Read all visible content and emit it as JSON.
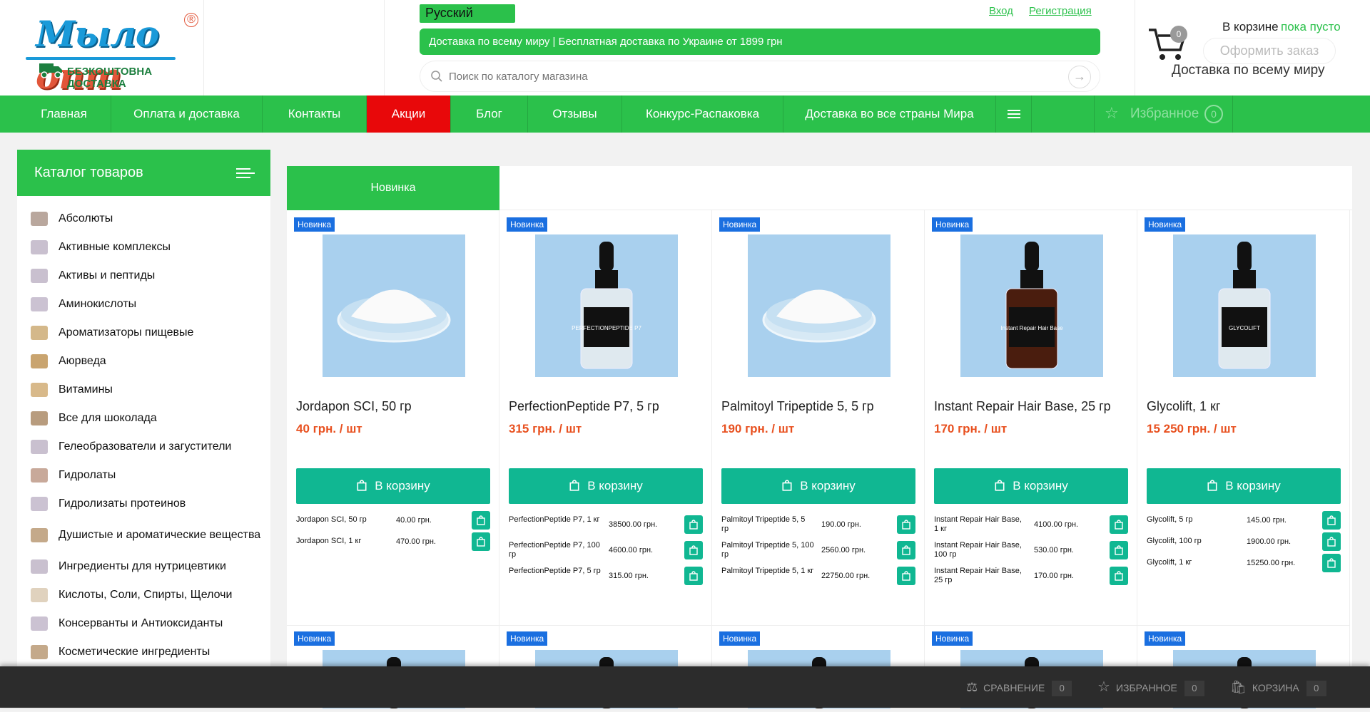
{
  "header": {
    "logo_text": "Мыло опт",
    "logo_sub": "БЕЗКОШТОВНА ДОСТАВКА",
    "language": "Русский",
    "login": "Вход",
    "register": "Регистрация",
    "promo": "Доставка по всему миру  |  Бесплатная доставка по Украине от 1899 грн",
    "search_placeholder": "Поиск по каталогу магазина",
    "cart_count": "0",
    "cart_label": "В корзине",
    "cart_status": "пока пусто",
    "order_button": "Оформить заказ",
    "shipping_note": "Доставка по всему миру"
  },
  "nav": {
    "items": [
      "Главная",
      "Оплата и доставка",
      "Контакты",
      "Акции",
      "Блог",
      "Отзывы",
      "Конкурс-Распаковка",
      "Доставка во все страны Мира"
    ],
    "favorites_label": "Избранное",
    "favorites_count": "0"
  },
  "sidebar": {
    "title": "Каталог товаров",
    "categories": [
      "Абсолюты",
      "Активные комплексы",
      "Активы и пептиды",
      "Аминокислоты",
      "Ароматизаторы пищевые",
      "Аюрведа",
      "Витамины",
      "Все для шоколада",
      "Гелеобразователи и загустители",
      "Гидролаты",
      "Гидролизаты протеинов",
      "Душистые и ароматические вещества",
      "Ингредиенты для нутрицевтики",
      "Кислоты, Соли, Спирты, Щелочи",
      "Консерванты и Антиоксиданты",
      "Косметические ингредиенты"
    ]
  },
  "tabs": {
    "active": "Новинка"
  },
  "products": [
    {
      "badge": "Новинка",
      "name": "Jordapon SCI, 50 гр",
      "price": "40 грн. / шт",
      "button": "В корзину",
      "variants": [
        {
          "name": "Jordapon SCI, 50 гр",
          "price": "40.00 грн."
        },
        {
          "name": "Jordapon SCI, 1 кг",
          "price": "470.00 грн."
        }
      ]
    },
    {
      "badge": "Новинка",
      "name": "PerfectionPeptide P7, 5 гр",
      "price": "315 грн. / шт",
      "button": "В корзину",
      "variants": [
        {
          "name": "PerfectionPeptide P7, 1 кг",
          "price": "38500.00 грн."
        },
        {
          "name": "PerfectionPeptide P7, 100 гр",
          "price": "4600.00 грн."
        },
        {
          "name": "PerfectionPeptide P7, 5 гр",
          "price": "315.00 грн."
        }
      ]
    },
    {
      "badge": "Новинка",
      "name": "Palmitoyl Tripeptide 5, 5 гр",
      "price": "190 грн. / шт",
      "button": "В корзину",
      "variants": [
        {
          "name": "Palmitoyl Tripeptide 5, 5 гр",
          "price": "190.00 грн."
        },
        {
          "name": "Palmitoyl Tripeptide 5, 100 гр",
          "price": "2560.00 грн."
        },
        {
          "name": "Palmitoyl Tripeptide 5, 1 кг",
          "price": "22750.00 грн."
        }
      ]
    },
    {
      "badge": "Новинка",
      "name": "Instant Repair Hair Base, 25 гр",
      "price": "170 грн. / шт",
      "button": "В корзину",
      "variants": [
        {
          "name": "Instant Repair Hair Base, 1 кг",
          "price": "4100.00 грн."
        },
        {
          "name": "Instant Repair Hair Base, 100 гр",
          "price": "530.00 грн."
        },
        {
          "name": "Instant Repair Hair Base, 25 гр",
          "price": "170.00 грн."
        }
      ]
    },
    {
      "badge": "Новинка",
      "name": "Glycolift, 1 кг",
      "price": "15 250 грн. / шт",
      "button": "В корзину",
      "variants": [
        {
          "name": "Glycolift, 5 гр",
          "price": "145.00 грн."
        },
        {
          "name": "Glycolift, 100 гр",
          "price": "1900.00 грн."
        },
        {
          "name": "Glycolift, 1 кг",
          "price": "15250.00 грн."
        }
      ]
    }
  ],
  "product_images": [
    {
      "type": "powder",
      "label": ""
    },
    {
      "type": "bottle-clear",
      "label": "PERFECTIONPEPTIDE P7"
    },
    {
      "type": "powder",
      "label": ""
    },
    {
      "type": "bottle-amber",
      "label": "Instant Repair Hair Base"
    },
    {
      "type": "bottle-clear",
      "label": "GLYCOLIFT"
    }
  ],
  "row2_badges": [
    "Новинка",
    "Новинка",
    "Новинка",
    "Новинка",
    "Новинка"
  ],
  "bottom_bar": {
    "compare_label": "СРАВНЕНИЕ",
    "compare_count": "0",
    "favorites_label": "ИЗБРАННОЕ",
    "favorites_count": "0",
    "cart_label": "КОРЗИНА",
    "cart_count": "0"
  },
  "colors": {
    "brand_green": "#2bc14b",
    "sale_red": "#e8080a",
    "button_teal": "#10b792",
    "price_orange": "#e8501f",
    "badge_blue": "#1a6fe0"
  }
}
